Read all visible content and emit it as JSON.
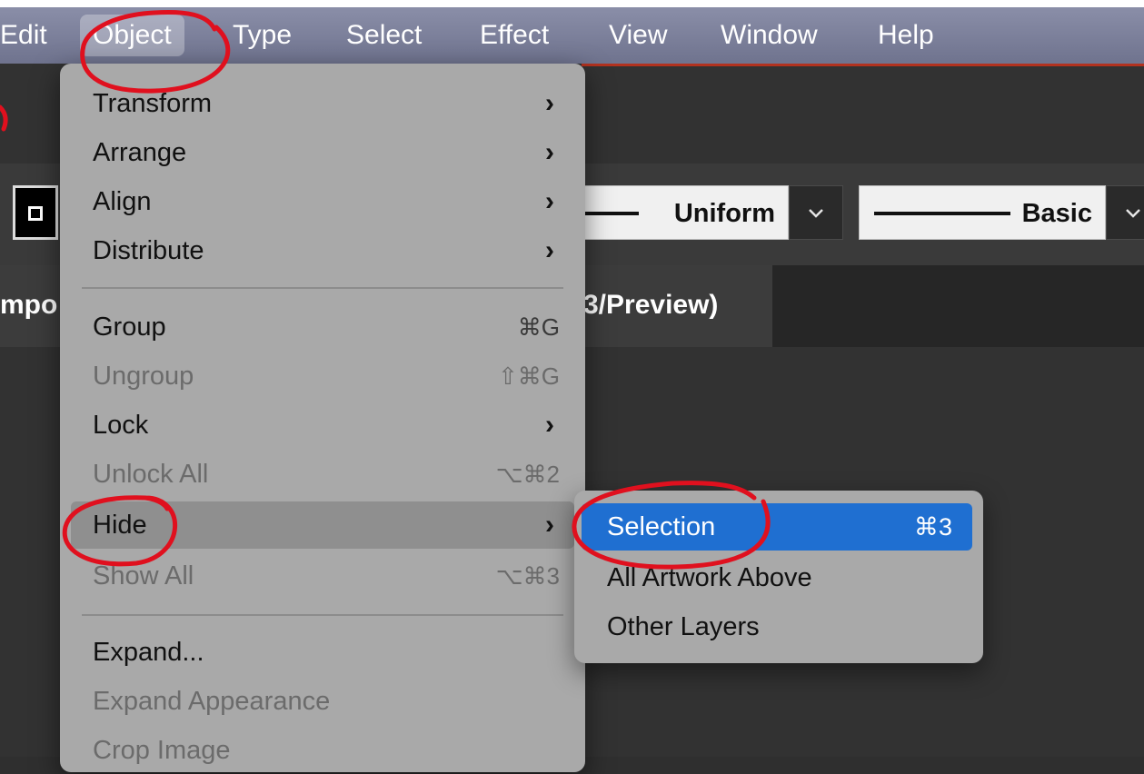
{
  "menubar": {
    "items": [
      {
        "label": "Edit"
      },
      {
        "label": "Object"
      },
      {
        "label": "Type"
      },
      {
        "label": "Select"
      },
      {
        "label": "Effect"
      },
      {
        "label": "View"
      },
      {
        "label": "Window"
      },
      {
        "label": "Help"
      }
    ]
  },
  "control_bar": {
    "stroke_profile": "Uniform",
    "brush": "Basic"
  },
  "tabs": [
    {
      "label": "mpo"
    },
    {
      "label": "3/Preview)"
    }
  ],
  "object_menu": {
    "items": [
      {
        "label": "Transform",
        "shortcut": "",
        "chevron": "›"
      },
      {
        "label": "Arrange",
        "shortcut": "",
        "chevron": "›"
      },
      {
        "label": "Align",
        "shortcut": "",
        "chevron": "›"
      },
      {
        "label": "Distribute",
        "shortcut": "",
        "chevron": "›"
      },
      {
        "label": "Group",
        "shortcut": "⌘G",
        "chevron": ""
      },
      {
        "label": "Ungroup",
        "shortcut": "⇧⌘G",
        "chevron": ""
      },
      {
        "label": "Lock",
        "shortcut": "",
        "chevron": "›"
      },
      {
        "label": "Unlock All",
        "shortcut": "⌥⌘2",
        "chevron": ""
      },
      {
        "label": "Hide",
        "shortcut": "",
        "chevron": "›"
      },
      {
        "label": "Show All",
        "shortcut": "⌥⌘3",
        "chevron": ""
      },
      {
        "label": "Expand...",
        "shortcut": "",
        "chevron": ""
      },
      {
        "label": "Expand Appearance",
        "shortcut": "",
        "chevron": ""
      },
      {
        "label": "Crop Image",
        "shortcut": "",
        "chevron": ""
      }
    ]
  },
  "hide_submenu": {
    "items": [
      {
        "label": "Selection",
        "shortcut": "⌘3"
      },
      {
        "label": "All Artwork Above",
        "shortcut": ""
      },
      {
        "label": "Other Layers",
        "shortcut": ""
      }
    ]
  },
  "colors": {
    "selection_highlight": "#1f6fd1",
    "annotation_red": "#e0101e",
    "menu_background": "#a9a9a9"
  },
  "icons": {
    "submenu_arrow": "chevron-right-icon",
    "dropdown_arrow": "chevron-down-icon"
  }
}
